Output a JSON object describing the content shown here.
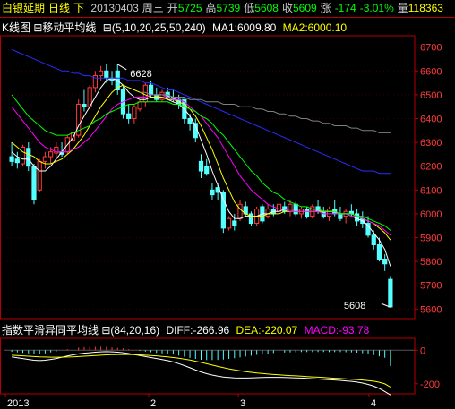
{
  "header": {
    "instrument": "白银延期",
    "period": "日线",
    "extra": "下",
    "date": "20130403",
    "weekday": "周三",
    "open_label": "开",
    "open": "5725",
    "high_label": "高",
    "high": "5739",
    "low_label": "低",
    "low": "5608",
    "close_label": "收",
    "close": "5609",
    "change_label": "涨",
    "change": "-174",
    "change_pct": "-3.01%",
    "volume_label": "量",
    "volume": "118363"
  },
  "kline_bar": {
    "title": "K线图",
    "indicator": "移动平均线",
    "params": "(5,10,20,25,50,240)",
    "ma1": "MA1:6009.80",
    "ma2": "MA2:6000.10"
  },
  "macd_bar": {
    "title": "指数平滑异同平均线",
    "params": "(84,20,16)",
    "diff": "DIFF:-266.96",
    "dea": "DEA:-220.07",
    "macd": "MACD:-93.78"
  },
  "colors": {
    "up": "#ff3c3c",
    "down": "#54ffff",
    "axis": "#b40000",
    "ma1": "#ffffff",
    "ma2": "#ffff00",
    "ma3": "#ff00ff",
    "ma4": "#00ff00",
    "ma5": "#2b2bff",
    "ma6": "#808080"
  },
  "chart_data": [
    {
      "type": "candlestick",
      "title": "K线图",
      "y_ticks": [
        5600,
        5700,
        5800,
        5900,
        6000,
        6100,
        6200,
        6300,
        6400,
        6500,
        6600,
        6700
      ],
      "ylim": [
        5560,
        6740
      ],
      "x_ticks": [
        "2013",
        "2",
        "3",
        "4"
      ],
      "annotations": [
        {
          "text": "6628",
          "value": 6628
        },
        {
          "text": "5608",
          "value": 5608
        }
      ],
      "candles": [
        [
          6240,
          6300,
          6200,
          6220
        ],
        [
          6230,
          6260,
          6190,
          6215
        ],
        [
          6210,
          6290,
          6200,
          6280
        ],
        [
          6275,
          6300,
          6180,
          6200
        ],
        [
          6200,
          6210,
          6040,
          6060
        ],
        [
          6100,
          6230,
          6090,
          6220
        ],
        [
          6220,
          6260,
          6190,
          6240
        ],
        [
          6240,
          6280,
          6210,
          6260
        ],
        [
          6255,
          6300,
          6230,
          6280
        ],
        [
          6260,
          6300,
          6240,
          6250
        ],
        [
          6260,
          6330,
          6250,
          6320
        ],
        [
          6310,
          6360,
          6290,
          6340
        ],
        [
          6330,
          6480,
          6320,
          6460
        ],
        [
          6460,
          6520,
          6430,
          6450
        ],
        [
          6450,
          6540,
          6440,
          6530
        ],
        [
          6530,
          6600,
          6510,
          6580
        ],
        [
          6580,
          6620,
          6560,
          6600
        ],
        [
          6600,
          6630,
          6550,
          6570
        ],
        [
          6570,
          6600,
          6540,
          6560
        ],
        [
          6600,
          6628,
          6500,
          6520
        ],
        [
          6520,
          6540,
          6400,
          6420
        ],
        [
          6420,
          6460,
          6380,
          6400
        ],
        [
          6400,
          6460,
          6380,
          6450
        ],
        [
          6440,
          6480,
          6430,
          6470
        ],
        [
          6470,
          6550,
          6450,
          6540
        ],
        [
          6540,
          6560,
          6490,
          6500
        ],
        [
          6500,
          6530,
          6470,
          6480
        ],
        [
          6480,
          6520,
          6470,
          6510
        ],
        [
          6510,
          6530,
          6480,
          6490
        ],
        [
          6490,
          6520,
          6470,
          6480
        ],
        [
          6480,
          6500,
          6440,
          6460
        ],
        [
          6480,
          6470,
          6380,
          6400
        ],
        [
          6400,
          6420,
          6350,
          6380
        ],
        [
          6380,
          6400,
          6300,
          6320
        ],
        [
          6220,
          6250,
          6150,
          6180
        ],
        [
          6200,
          6230,
          6160,
          6170
        ],
        [
          6100,
          6130,
          6060,
          6080
        ],
        [
          6110,
          6130,
          6060,
          6090
        ],
        [
          6090,
          6100,
          5920,
          5940
        ],
        [
          5940,
          5990,
          5930,
          5980
        ],
        [
          5970,
          6000,
          5930,
          5950
        ],
        [
          5980,
          6060,
          5970,
          6040
        ],
        [
          6030,
          6050,
          5990,
          6000
        ],
        [
          6000,
          6010,
          5950,
          5960
        ],
        [
          5960,
          6030,
          5950,
          6020
        ],
        [
          6030,
          6040,
          5960,
          5970
        ],
        [
          5990,
          6040,
          5980,
          6020
        ],
        [
          6020,
          6040,
          5990,
          6000
        ],
        [
          6010,
          6050,
          6000,
          6040
        ],
        [
          6030,
          6050,
          6000,
          6010
        ],
        [
          6010,
          6060,
          5990,
          6040
        ],
        [
          6040,
          6050,
          5990,
          6000
        ],
        [
          6000,
          6030,
          5980,
          6020
        ],
        [
          6020,
          6030,
          5980,
          5990
        ],
        [
          5990,
          6040,
          5980,
          6030
        ],
        [
          6030,
          6060,
          6000,
          6010
        ],
        [
          6010,
          6030,
          5980,
          5990
        ],
        [
          5990,
          6030,
          5970,
          6020
        ],
        [
          6020,
          6060,
          5990,
          6000
        ],
        [
          6000,
          6030,
          5970,
          5980
        ],
        [
          5990,
          6020,
          5960,
          6010
        ],
        [
          6010,
          6040,
          5990,
          6000
        ],
        [
          6000,
          6020,
          5950,
          5970
        ],
        [
          5980,
          6010,
          5940,
          5960
        ],
        [
          5960,
          5990,
          5900,
          5910
        ],
        [
          5910,
          5930,
          5850,
          5870
        ],
        [
          5870,
          5900,
          5800,
          5810
        ],
        [
          5810,
          5830,
          5760,
          5790
        ],
        [
          5725,
          5739,
          5608,
          5609
        ]
      ],
      "series": [
        {
          "name": "MA1",
          "values": [
            6260,
            6240,
            6230,
            6230,
            6200,
            6180,
            6180,
            6200,
            6230,
            6260,
            6290,
            6320,
            6370,
            6410,
            6450,
            6490,
            6530,
            6560,
            6570,
            6560,
            6540,
            6510,
            6490,
            6480,
            6480,
            6490,
            6490,
            6490,
            6480,
            6470,
            6460,
            6440,
            6410,
            6370,
            6310,
            6250,
            6180,
            6120,
            6060,
            6010,
            5980,
            5980,
            5990,
            5990,
            5990,
            6000,
            6000,
            6010,
            6010,
            6020,
            6020,
            6020,
            6020,
            6020,
            6020,
            6020,
            6010,
            6010,
            6010,
            6000,
            6000,
            5990,
            5980,
            5970,
            5950,
            5920,
            5890,
            5850,
            5780
          ]
        },
        {
          "name": "MA2",
          "values": [
            6300,
            6280,
            6260,
            6250,
            6240,
            6220,
            6210,
            6210,
            6220,
            6230,
            6250,
            6270,
            6300,
            6330,
            6370,
            6410,
            6450,
            6480,
            6510,
            6530,
            6540,
            6530,
            6520,
            6510,
            6500,
            6490,
            6490,
            6490,
            6480,
            6480,
            6470,
            6460,
            6440,
            6410,
            6370,
            6320,
            6270,
            6210,
            6150,
            6100,
            6050,
            6020,
            6000,
            5990,
            5990,
            5990,
            6000,
            6000,
            6000,
            6010,
            6010,
            6010,
            6010,
            6010,
            6010,
            6010,
            6010,
            6010,
            6010,
            6000,
            6000,
            6000,
            5990,
            5980,
            5970,
            5960,
            5940,
            5920,
            5890
          ]
        },
        {
          "name": "MA3",
          "values": [
            6450,
            6420,
            6390,
            6360,
            6330,
            6300,
            6280,
            6270,
            6260,
            6260,
            6260,
            6270,
            6280,
            6300,
            6320,
            6350,
            6380,
            6410,
            6440,
            6460,
            6470,
            6480,
            6490,
            6490,
            6490,
            6500,
            6500,
            6500,
            6490,
            6480,
            6480,
            6470,
            6450,
            6430,
            6410,
            6380,
            6350,
            6320,
            6280,
            6240,
            6200,
            6160,
            6130,
            6100,
            6080,
            6060,
            6040,
            6030,
            6020,
            6020,
            6010,
            6010,
            6010,
            6010,
            6010,
            6010,
            6000,
            6000,
            6000,
            6000,
            6000,
            5990,
            5990,
            5980,
            5970,
            5960,
            5950,
            5930,
            5910
          ]
        },
        {
          "name": "MA4",
          "values": [
            6500,
            6470,
            6440,
            6410,
            6390,
            6370,
            6350,
            6340,
            6330,
            6330,
            6330,
            6340,
            6350,
            6360,
            6370,
            6390,
            6400,
            6420,
            6430,
            6440,
            6450,
            6460,
            6460,
            6470,
            6470,
            6470,
            6470,
            6470,
            6470,
            6460,
            6460,
            6450,
            6440,
            6430,
            6410,
            6400,
            6380,
            6350,
            6330,
            6300,
            6270,
            6240,
            6210,
            6180,
            6160,
            6130,
            6110,
            6090,
            6080,
            6060,
            6050,
            6040,
            6030,
            6030,
            6020,
            6020,
            6010,
            6010,
            6010,
            6000,
            6000,
            6000,
            5990,
            5990,
            5980,
            5970,
            5960,
            5950,
            5930
          ]
        },
        {
          "name": "MA5",
          "values": [
            6690,
            6680,
            6670,
            6660,
            6650,
            6640,
            6630,
            6620,
            6610,
            6600,
            6600,
            6590,
            6590,
            6580,
            6580,
            6570,
            6570,
            6570,
            6570,
            6570,
            6570,
            6560,
            6560,
            6560,
            6550,
            6550,
            6540,
            6530,
            6520,
            6520,
            6510,
            6500,
            6490,
            6480,
            6470,
            6460,
            6450,
            6440,
            6430,
            6420,
            6410,
            6400,
            6390,
            6380,
            6370,
            6360,
            6350,
            6340,
            6330,
            6320,
            6310,
            6300,
            6290,
            6280,
            6270,
            6260,
            6250,
            6240,
            6230,
            6220,
            6210,
            6200,
            6190,
            6180,
            6180,
            6180,
            6170,
            6170,
            6170
          ]
        },
        {
          "name": "MA6",
          "values": [
            null,
            null,
            null,
            null,
            null,
            null,
            null,
            null,
            null,
            null,
            null,
            null,
            null,
            null,
            null,
            null,
            null,
            null,
            null,
            null,
            null,
            null,
            null,
            6510,
            6510,
            6500,
            6500,
            6500,
            6500,
            6490,
            6490,
            6490,
            6480,
            6480,
            6480,
            6470,
            6470,
            6470,
            6460,
            6460,
            6460,
            6450,
            6450,
            6450,
            6440,
            6440,
            6430,
            6430,
            6420,
            6420,
            6410,
            6410,
            6400,
            6400,
            6390,
            6390,
            6380,
            6380,
            6370,
            6370,
            6370,
            6360,
            6360,
            6350,
            6350,
            6350,
            6340,
            6340,
            6340
          ]
        }
      ]
    },
    {
      "type": "macd",
      "title": "指数平滑异同平均线",
      "y_ticks": [
        0,
        -200
      ],
      "ylim": [
        -260,
        60
      ],
      "x_ticks": [
        "2013",
        "2",
        "3",
        "4"
      ],
      "diff": [
        -40,
        -45,
        -50,
        -55,
        -60,
        -62,
        -60,
        -55,
        -50,
        -42,
        -35,
        -28,
        -22,
        -18,
        -15,
        -12,
        -10,
        -9,
        -10,
        -12,
        -15,
        -20,
        -26,
        -32,
        -38,
        -44,
        -50,
        -56,
        -62,
        -70,
        -80,
        -92,
        -105,
        -118,
        -130,
        -140,
        -148,
        -155,
        -160,
        -163,
        -165,
        -166,
        -166,
        -165,
        -164,
        -163,
        -162,
        -162,
        -162,
        -163,
        -164,
        -165,
        -166,
        -168,
        -170,
        -172,
        -174,
        -176,
        -178,
        -180,
        -183,
        -186,
        -190,
        -196,
        -204,
        -214,
        -228,
        -246,
        -267
      ],
      "dea": [
        -30,
        -32,
        -34,
        -36,
        -38,
        -40,
        -41,
        -42,
        -42,
        -42,
        -41,
        -40,
        -38,
        -36,
        -34,
        -32,
        -30,
        -28,
        -27,
        -26,
        -26,
        -26,
        -27,
        -28,
        -30,
        -32,
        -34,
        -37,
        -40,
        -44,
        -48,
        -53,
        -59,
        -66,
        -73,
        -81,
        -89,
        -97,
        -104,
        -111,
        -117,
        -123,
        -128,
        -132,
        -136,
        -139,
        -142,
        -145,
        -147,
        -149,
        -151,
        -153,
        -155,
        -157,
        -159,
        -161,
        -163,
        -165,
        -167,
        -169,
        -171,
        -173,
        -175,
        -178,
        -181,
        -185,
        -191,
        -201,
        -220
      ],
      "macd": [
        -10,
        -13,
        -16,
        -19,
        -22,
        -22,
        -19,
        -13,
        -8,
        0,
        6,
        12,
        16,
        18,
        19,
        20,
        20,
        19,
        17,
        14,
        11,
        6,
        1,
        -4,
        -8,
        -12,
        -16,
        -19,
        -22,
        -26,
        -32,
        -39,
        -46,
        -52,
        -57,
        -59,
        -59,
        -58,
        -56,
        -52,
        -48,
        -43,
        -38,
        -33,
        -28,
        -24,
        -20,
        -17,
        -15,
        -14,
        -13,
        -12,
        -11,
        -11,
        -11,
        -11,
        -11,
        -11,
        -11,
        -11,
        -12,
        -13,
        -15,
        -18,
        -23,
        -29,
        -37,
        -45,
        -94
      ]
    }
  ]
}
